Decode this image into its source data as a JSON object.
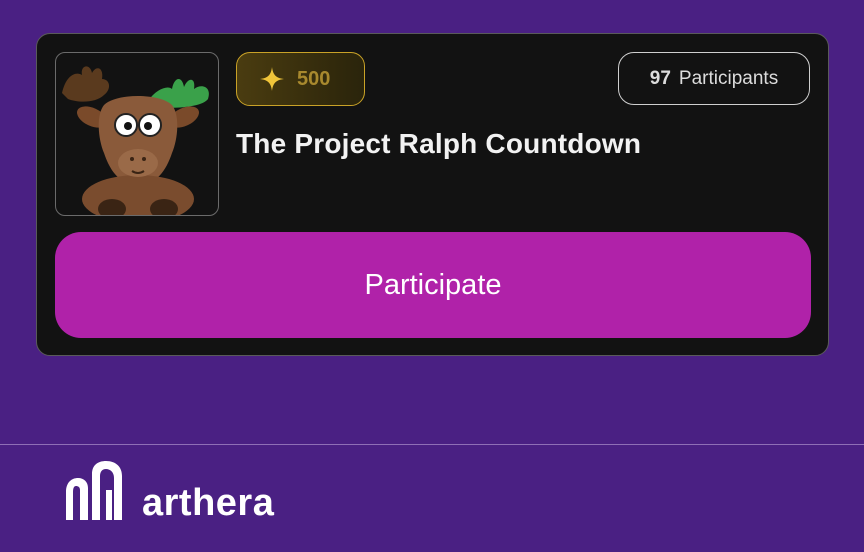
{
  "card": {
    "points_value": "500",
    "participants_count": "97",
    "participants_label": "Participants",
    "title": "The Project Ralph Countdown",
    "cta_label": "Participate"
  },
  "footer": {
    "brand_name": "arthera"
  },
  "icons": {
    "points": "sparkle-icon",
    "thumbnail": "moose-illustration",
    "logo": "arthera-logo-mark"
  },
  "colors": {
    "background": "#4a2083",
    "card": "#121212",
    "accent_button": "#b022a9",
    "gold": "#c9a227"
  }
}
